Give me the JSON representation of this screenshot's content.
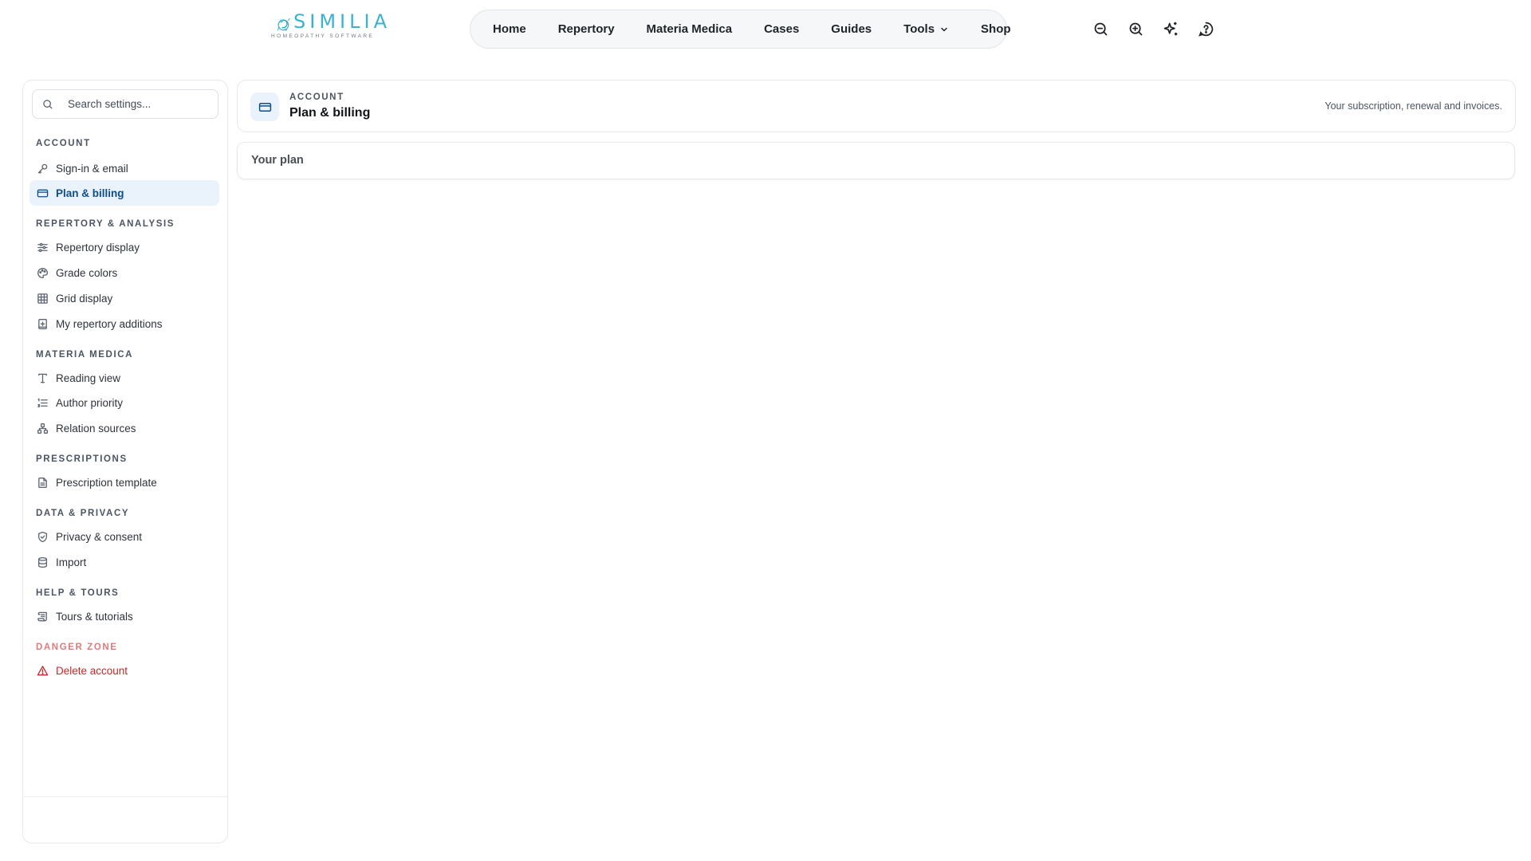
{
  "brand": {
    "name": "SIMILIA",
    "tagline": "HOMEOPATHY SOFTWARE",
    "color": "#3bb3cf"
  },
  "nav": {
    "items": [
      {
        "label": "Home"
      },
      {
        "label": "Repertory"
      },
      {
        "label": "Materia Medica"
      },
      {
        "label": "Cases"
      },
      {
        "label": "Guides"
      },
      {
        "label": "Tools",
        "has_dropdown": true
      },
      {
        "label": "Shop"
      }
    ]
  },
  "top_icons": [
    "zoom-out-icon",
    "zoom-in-icon",
    "sparkles-icon",
    "help-icon"
  ],
  "sidebar": {
    "search_placeholder": "Search settings...",
    "sections": {
      "account": "ACCOUNT",
      "repertory": "REPERTORY & ANALYSIS",
      "materia": "MATERIA MEDICA",
      "prescriptions": "PRESCRIPTIONS",
      "data": "DATA & PRIVACY",
      "help": "HELP & TOURS",
      "danger": "DANGER ZONE"
    },
    "items": {
      "signin": {
        "label": "Sign-in & email",
        "icon": "key-icon"
      },
      "plan": {
        "label": "Plan & billing",
        "icon": "credit-card-icon",
        "active": true
      },
      "repertory_display": {
        "label": "Repertory display",
        "icon": "sliders-icon"
      },
      "grade_colors": {
        "label": "Grade colors",
        "icon": "palette-icon"
      },
      "grid_display": {
        "label": "Grid display",
        "icon": "grid-icon"
      },
      "my_additions": {
        "label": "My repertory additions",
        "icon": "book-plus-icon"
      },
      "reading_view": {
        "label": "Reading view",
        "icon": "type-icon"
      },
      "author_priority": {
        "label": "Author priority",
        "icon": "list-ordered-icon"
      },
      "relation_sources": {
        "label": "Relation sources",
        "icon": "network-icon"
      },
      "prescription_template": {
        "label": "Prescription template",
        "icon": "file-text-icon"
      },
      "privacy": {
        "label": "Privacy & consent",
        "icon": "shield-check-icon"
      },
      "import": {
        "label": "Import",
        "icon": "database-icon"
      },
      "tours": {
        "label": "Tours & tutorials",
        "icon": "scroll-icon"
      },
      "delete": {
        "label": "Delete account",
        "icon": "warning-icon"
      }
    }
  },
  "header": {
    "eyebrow": "ACCOUNT",
    "title": "Plan & billing",
    "description": "Your subscription, renewal and invoices."
  },
  "plan_card": {
    "title": "Your plan"
  },
  "colors": {
    "accent": "#0f4c8a",
    "active_bg": "#eaf2fc",
    "danger": "#c62828",
    "danger_heading": "#e07b7b"
  }
}
